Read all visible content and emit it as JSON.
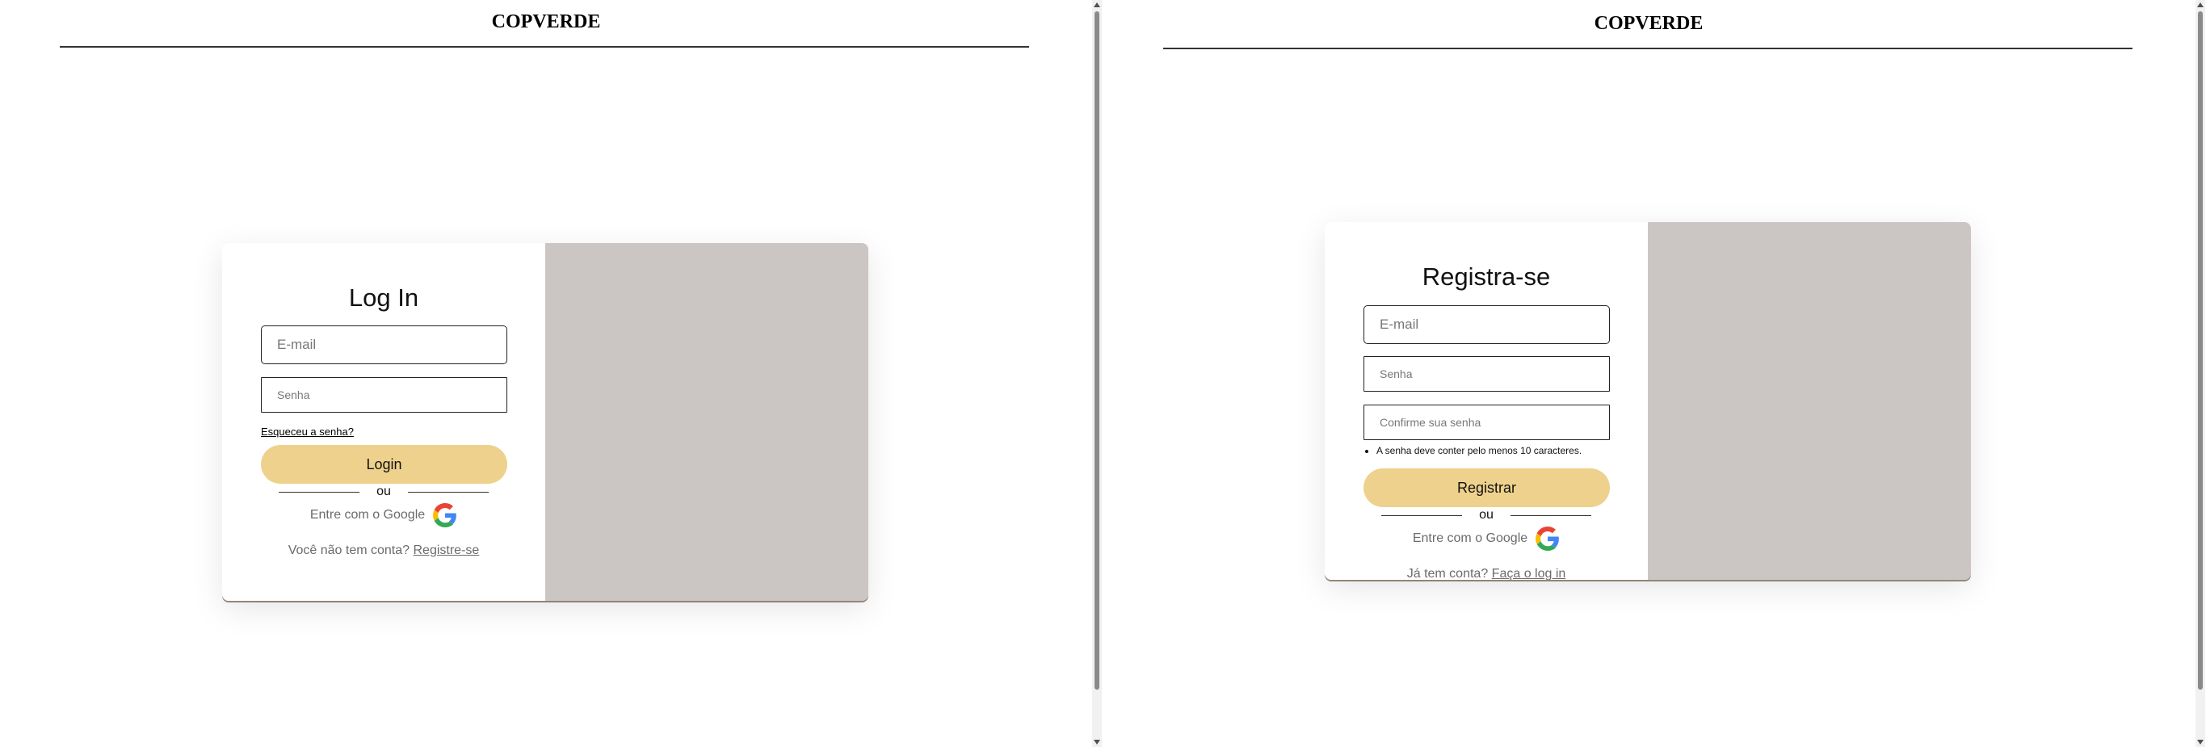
{
  "login_page": {
    "brand": "COPVERDE",
    "title": "Log In",
    "email_placeholder": "E-mail",
    "password_placeholder": "Senha",
    "forgot_link": "Esqueceu a senha?",
    "login_button": "Login",
    "divider_text": "ou",
    "google_text": "Entre com o Google",
    "footer_prompt": "Você não tem conta?",
    "footer_link": "Registre-se"
  },
  "register_page": {
    "brand": "COPVERDE",
    "title": "Registra-se",
    "email_placeholder": "E-mail",
    "password_placeholder": "Senha",
    "confirm_placeholder": "Confirme sua senha",
    "password_hint": "A senha deve conter pelo menos 10 caracteres.",
    "register_button": "Registrar",
    "divider_text": "ou",
    "google_text": "Entre com o Google",
    "footer_prompt": "Já tem conta?",
    "footer_link": "Faça o log in"
  },
  "colors": {
    "button": "#eed18c",
    "image_panel": "#cbc5c4"
  },
  "icons": {
    "google": "google-icon"
  }
}
